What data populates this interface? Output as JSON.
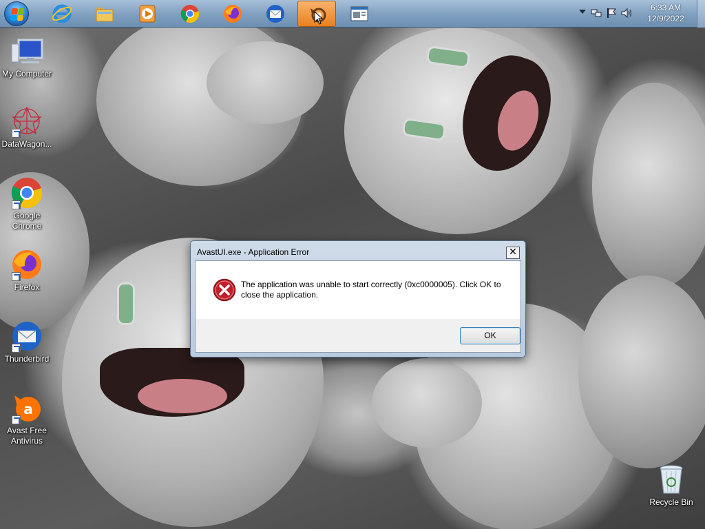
{
  "taskbar": {
    "apps": [
      {
        "name": "internet-explorer",
        "icon": "ie-icon"
      },
      {
        "name": "file-explorer",
        "icon": "folder-icon"
      },
      {
        "name": "media-player",
        "icon": "media-player-icon"
      },
      {
        "name": "chrome",
        "icon": "chrome-icon"
      },
      {
        "name": "firefox",
        "icon": "firefox-icon"
      },
      {
        "name": "thunderbird",
        "icon": "thunderbird-icon"
      },
      {
        "name": "avast",
        "icon": "avast-icon",
        "active": true
      },
      {
        "name": "window",
        "icon": "window-icon"
      }
    ],
    "clock": {
      "time": "6:33 AM",
      "date": "12/9/2022"
    }
  },
  "desktop": {
    "icons": [
      {
        "label": "My Computer"
      },
      {
        "label": "DataWagon..."
      },
      {
        "label": "Google Chrome",
        "line1": "Google",
        "line2": "Chrome"
      },
      {
        "label": "Firefox"
      },
      {
        "label": "Thunderbird"
      },
      {
        "label": "Avast Free Antivirus",
        "line1": "Avast Free",
        "line2": "Antivirus"
      },
      {
        "label": "Recycle Bin"
      }
    ]
  },
  "dialog": {
    "title": "AvastUI.exe - Application Error",
    "close": "✕",
    "message": "The application was unable to start correctly (0xc0000005). Click OK to close the application.",
    "ok_label": "OK"
  },
  "colors": {
    "taskbar_top": "#a7c0d9",
    "taskbar_bottom": "#6d8fb1",
    "active_button": "#e9801f",
    "error_red": "#c0202a"
  }
}
